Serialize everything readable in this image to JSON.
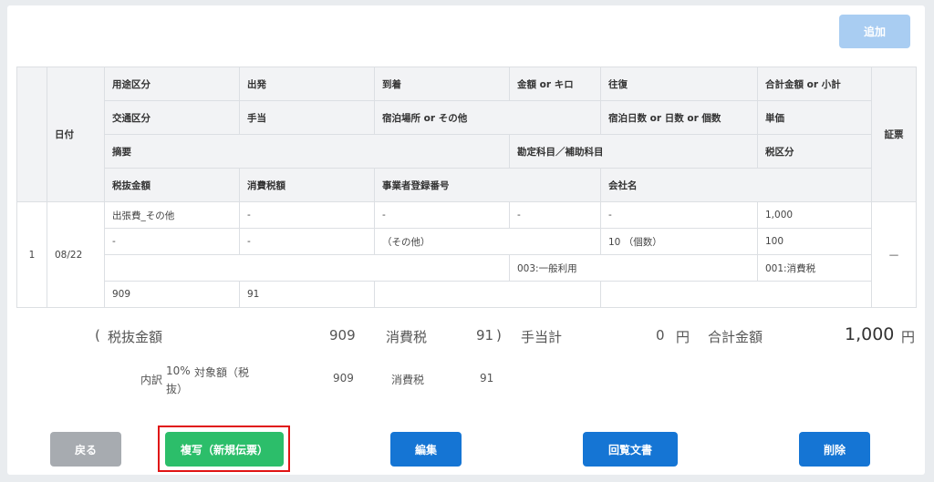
{
  "toolbar": {
    "add_label": "追加"
  },
  "table": {
    "headers": {
      "date": "日付",
      "row1": [
        "用途区分",
        "出発",
        "到着",
        "金額 or キロ",
        "往復",
        "合計金額 or 小計"
      ],
      "row2": [
        "交通区分",
        "手当",
        "宿泊場所 or その他",
        "宿泊日数 or 日数 or 個数",
        "単価"
      ],
      "row3": [
        "摘要",
        "勘定科目／補助科目",
        "税区分"
      ],
      "row4": [
        "税抜金額",
        "消費税額",
        "事業者登録番号",
        "会社名"
      ],
      "receipt": "証票"
    },
    "row": {
      "no": "1",
      "date": "08/22",
      "l1": [
        "出張費_その他",
        "-",
        "-",
        "-",
        "-",
        "1,000"
      ],
      "l2": [
        "-",
        "-",
        "（その他）",
        "10 （個数）",
        "100"
      ],
      "l3": [
        "",
        "003:一般利用",
        "001:消費税"
      ],
      "l4": [
        "909",
        "91",
        "",
        ""
      ],
      "receipt": "—"
    }
  },
  "summary": {
    "open_paren": "(",
    "pretax_label": "税抜金額",
    "pretax_value": "909",
    "tax_label": "消費税",
    "tax_value": "91",
    "close_paren": ")",
    "allowance_label": "手当計",
    "allowance_value": "0",
    "yen1": "円",
    "total_label": "合計金額",
    "total_value": "1,000",
    "yen2": "円",
    "breakdown_label": "内訳",
    "rate_label": "10%",
    "base_label_1": "対象額（税",
    "base_label_2": "抜）",
    "base_value": "909",
    "sub_tax_label": "消費税",
    "sub_tax_value": "91"
  },
  "actions": {
    "back": "戻る",
    "copy": "複写（新規伝票）",
    "edit": "編集",
    "circulation": "回覧文書",
    "delete": "削除"
  },
  "colors": {
    "primary": "#1575d4",
    "add_disabled": "#a9cdf2",
    "copy": "#2cbe6a",
    "back": "#a7abb0",
    "highlight": "#e01414"
  }
}
